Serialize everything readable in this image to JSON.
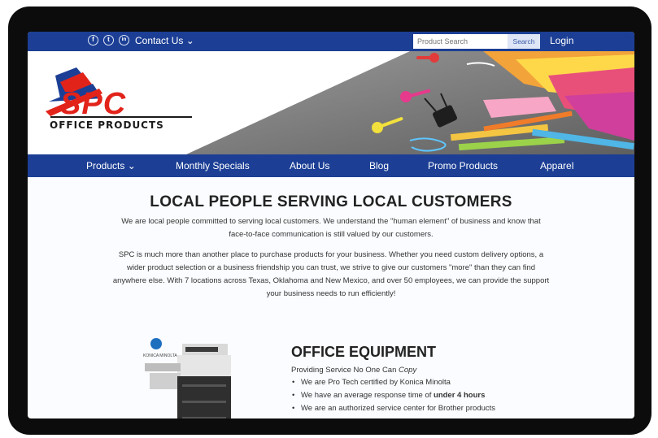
{
  "topbar": {
    "social": [
      {
        "icon": "facebook-icon",
        "glyph": "f"
      },
      {
        "icon": "twitter-icon",
        "glyph": "t"
      },
      {
        "icon": "linkedin-icon",
        "glyph": "in"
      }
    ],
    "contact_label": "Contact Us ⌄",
    "search_placeholder": "Product Search",
    "search_button": "Search",
    "login_label": "Login"
  },
  "hero": {
    "logo_text": "SPC",
    "logo_subtitle": "OFFICE PRODUCTS"
  },
  "nav": {
    "items": [
      {
        "label": "Products ⌄"
      },
      {
        "label": "Monthly Specials"
      },
      {
        "label": "About Us"
      },
      {
        "label": "Blog"
      },
      {
        "label": "Promo Products"
      },
      {
        "label": "Apparel"
      }
    ]
  },
  "main": {
    "headline": "LOCAL PEOPLE SERVING LOCAL CUSTOMERS",
    "intro_lines": [
      "We are local people committed to serving local customers. We understand the \"human element\" of business and know that",
      "face-to-face communication is still valued by our customers."
    ],
    "body_lines": [
      "SPC is much more than another place to purchase products for your business. Whether you need custom delivery options, a",
      "wider product selection or a business friendship you can trust, we strive to give our customers \"more\" than they can find",
      "anywhere else. With 7 locations across Texas, Oklahoma and New Mexico, and over 50 employees, we can provide the support",
      "your business needs to run efficiently!"
    ]
  },
  "equipment": {
    "title": "OFFICE EQUIPMENT",
    "subtitle_prefix": "Providing Service No One Can ",
    "subtitle_emphasis": "Copy",
    "bullets": [
      {
        "text": "We are Pro Tech certified by Konica Minolta",
        "bold": ""
      },
      {
        "text": "We have an average response time of ",
        "bold": "under 4 hours"
      },
      {
        "text": "We are an authorized service center for Brother products",
        "bold": ""
      }
    ],
    "printer_brand": "KONICA MINOLTA"
  },
  "colors": {
    "brand_blue": "#1c3f95",
    "logo_red": "#e2231a"
  }
}
